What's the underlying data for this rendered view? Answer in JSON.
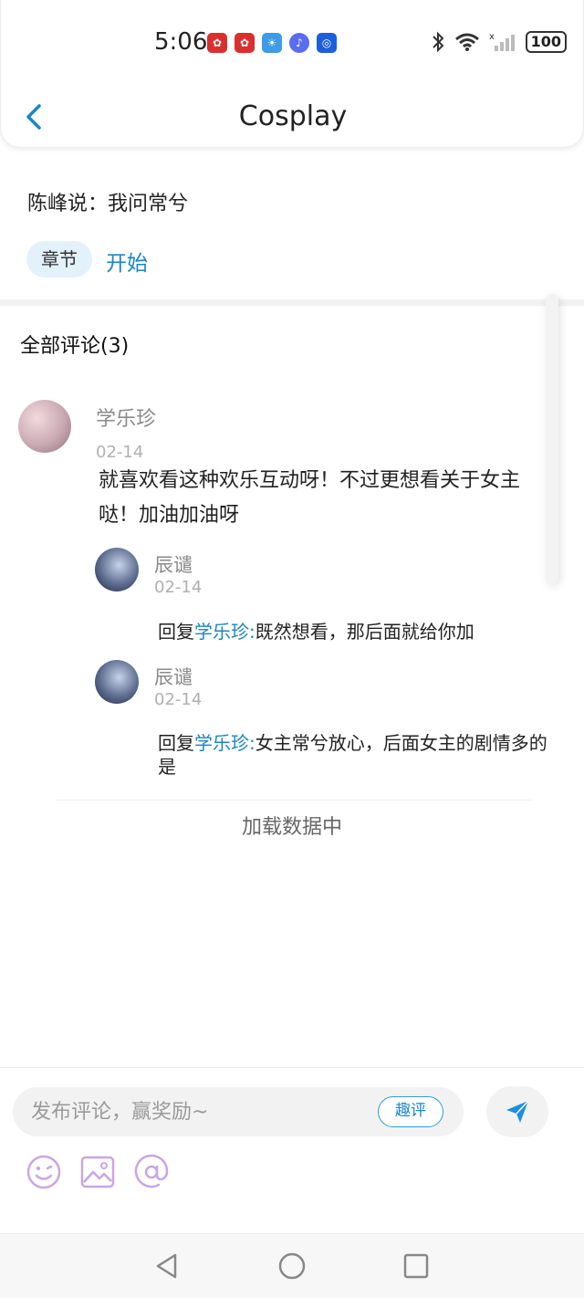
{
  "status_bar": {
    "time": "5:06",
    "battery": "100",
    "notification_icons": [
      "huawei-app-icon",
      "huawei-app-icon",
      "weather-icon",
      "music-icon",
      "bulb-icon"
    ]
  },
  "header": {
    "title": "Cosplay"
  },
  "chapter": {
    "text": "陈峰说：我问常兮",
    "badge": "章节",
    "link": "开始"
  },
  "comments": {
    "title": "全部评论(3)",
    "items": [
      {
        "name": "学乐珍",
        "date": "02-14",
        "content": "就喜欢看这种欢乐互动呀！不过更想看关于女主哒！加油加油呀",
        "replies": [
          {
            "name": "辰谴",
            "date": "02-14",
            "prefix": "回复",
            "target": "学乐珍:",
            "text": "既然想看，那后面就给你加"
          },
          {
            "name": "辰谴",
            "date": "02-14",
            "prefix": "回复",
            "target": "学乐珍:",
            "text": "女主常兮放心，后面女主的剧情多的是"
          }
        ]
      }
    ],
    "loading": "加载数据中"
  },
  "composer": {
    "placeholder": "发布评论，赢奖励~",
    "value": "",
    "quping_label": "趣评",
    "tools": [
      "emoji-icon",
      "image-icon",
      "mention-icon"
    ]
  },
  "colors": {
    "accent": "#1a86c6",
    "badge_bg": "#e3f1fb",
    "tool_icon": "#c9a6e6"
  }
}
